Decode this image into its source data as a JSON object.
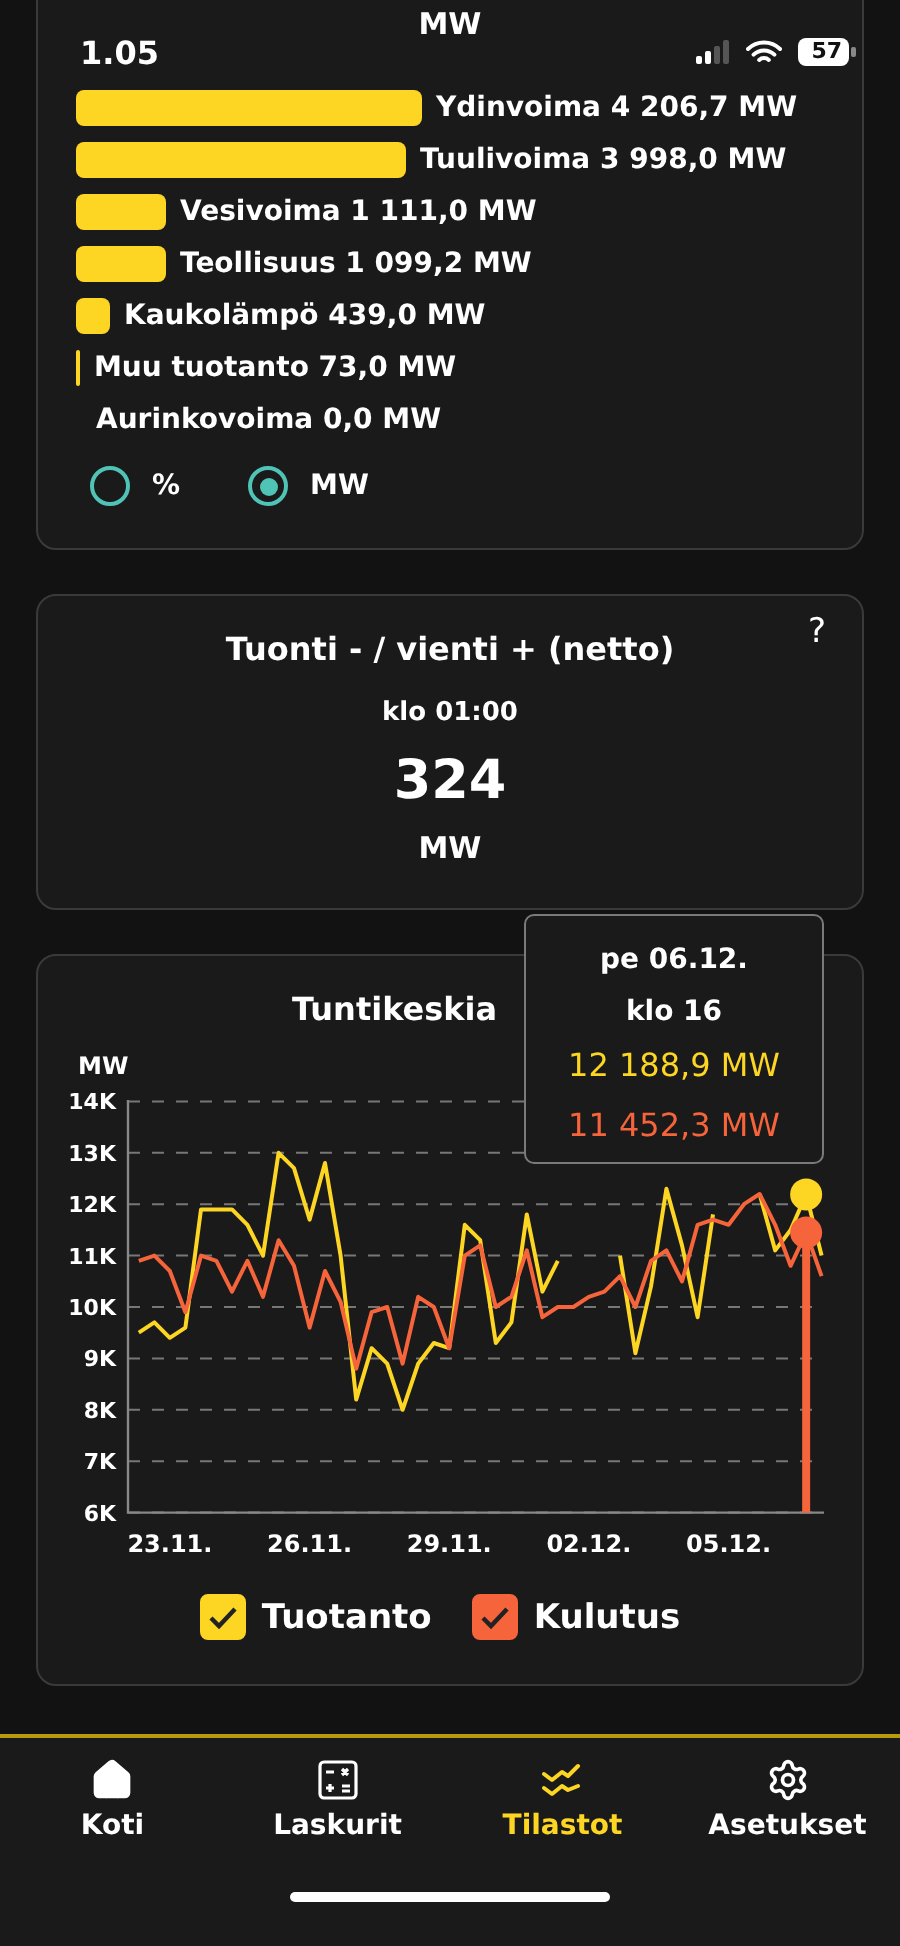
{
  "status_bar": {
    "time": "1.05",
    "battery": "57"
  },
  "production_card": {
    "unit_heading": "MW",
    "sources": [
      {
        "label": "Ydinvoima 4 206,7 MW"
      },
      {
        "label": "Tuulivoima 3 998,0 MW"
      },
      {
        "label": "Vesivoima 1 111,0 MW"
      },
      {
        "label": "Teollisuus 1 099,2 MW"
      },
      {
        "label": "Kaukolämpö 439,0 MW"
      },
      {
        "label": "Muu tuotanto 73,0 MW"
      },
      {
        "label": "Aurinkovoima 0,0 MW"
      }
    ],
    "unit_options": [
      {
        "label": "%",
        "selected": false
      },
      {
        "label": "MW",
        "selected": true
      }
    ]
  },
  "net_card": {
    "title": "Tuonti - / vienti + (netto)",
    "time": "klo 01:00",
    "value": "324",
    "unit": "MW",
    "help": "?"
  },
  "chart_card": {
    "title": "Tuntikeskia",
    "chart_data": {
      "type": "line",
      "ylabel": "MW",
      "categories": [
        null,
        null,
        "23.11.",
        null,
        null,
        null,
        null,
        null,
        null,
        null,
        null,
        "26.11.",
        null,
        null,
        null,
        null,
        null,
        null,
        null,
        null,
        "29.11.",
        null,
        null,
        null,
        null,
        null,
        null,
        null,
        null,
        "02.12.",
        null,
        null,
        null,
        null,
        null,
        null,
        null,
        null,
        "05.12.",
        null,
        null,
        null,
        null,
        null,
        null
      ],
      "series": [
        {
          "name": "Tuotanto",
          "color": "#fdd523",
          "values": [
            9.5,
            9.7,
            9.4,
            9.6,
            11.9,
            11.9,
            11.9,
            11.6,
            11.0,
            13.0,
            12.7,
            11.7,
            12.8,
            11.0,
            8.2,
            9.2,
            8.9,
            8.0,
            8.9,
            9.3,
            9.2,
            11.6,
            11.3,
            9.3,
            9.7,
            11.8,
            10.3,
            10.9,
            null,
            null,
            null,
            11.0,
            9.1,
            10.4,
            12.3,
            11.2,
            9.8,
            11.8,
            null,
            null,
            12.2,
            11.1,
            11.5,
            12.19,
            11.0
          ]
        },
        {
          "name": "Kulutus",
          "color": "#f5643a",
          "values": [
            10.9,
            11.0,
            10.7,
            9.9,
            11.0,
            10.9,
            10.3,
            10.9,
            10.2,
            11.3,
            10.8,
            9.6,
            10.7,
            10.1,
            8.8,
            9.9,
            10.0,
            8.9,
            10.2,
            10.0,
            9.2,
            11.0,
            11.2,
            10.0,
            10.2,
            11.1,
            9.8,
            10.0,
            10.0,
            10.2,
            10.3,
            10.6,
            10.0,
            10.9,
            11.1,
            10.5,
            11.6,
            11.7,
            11.6,
            12.0,
            12.2,
            11.6,
            10.8,
            11.45,
            10.6
          ]
        }
      ],
      "ylim": [
        6,
        14
      ],
      "yticks": [
        {
          "value": 6,
          "label": "6K"
        },
        {
          "value": 7,
          "label": "7K"
        },
        {
          "value": 8,
          "label": "8K"
        },
        {
          "value": 9,
          "label": "9K"
        },
        {
          "value": 10,
          "label": "10K"
        },
        {
          "value": 11,
          "label": "11K"
        },
        {
          "value": 12,
          "label": "12K"
        },
        {
          "value": 13,
          "label": "13K"
        },
        {
          "value": 14,
          "label": "14K"
        }
      ],
      "grid": true
    },
    "tooltip": {
      "date": "pe 06.12.",
      "time": "klo 16",
      "readings": [
        "12 188,9 MW",
        "11 452,3 MW"
      ]
    },
    "legend": [
      {
        "checked": true
      },
      {
        "checked": true
      }
    ]
  },
  "nav": [
    {
      "label": "Koti",
      "kind": "home",
      "selected": false
    },
    {
      "label": "Laskurit",
      "kind": "calculator",
      "selected": false
    },
    {
      "label": "Tilastot",
      "kind": "stats",
      "selected": true
    },
    {
      "label": "Asetukset",
      "kind": "settings",
      "selected": false
    }
  ]
}
